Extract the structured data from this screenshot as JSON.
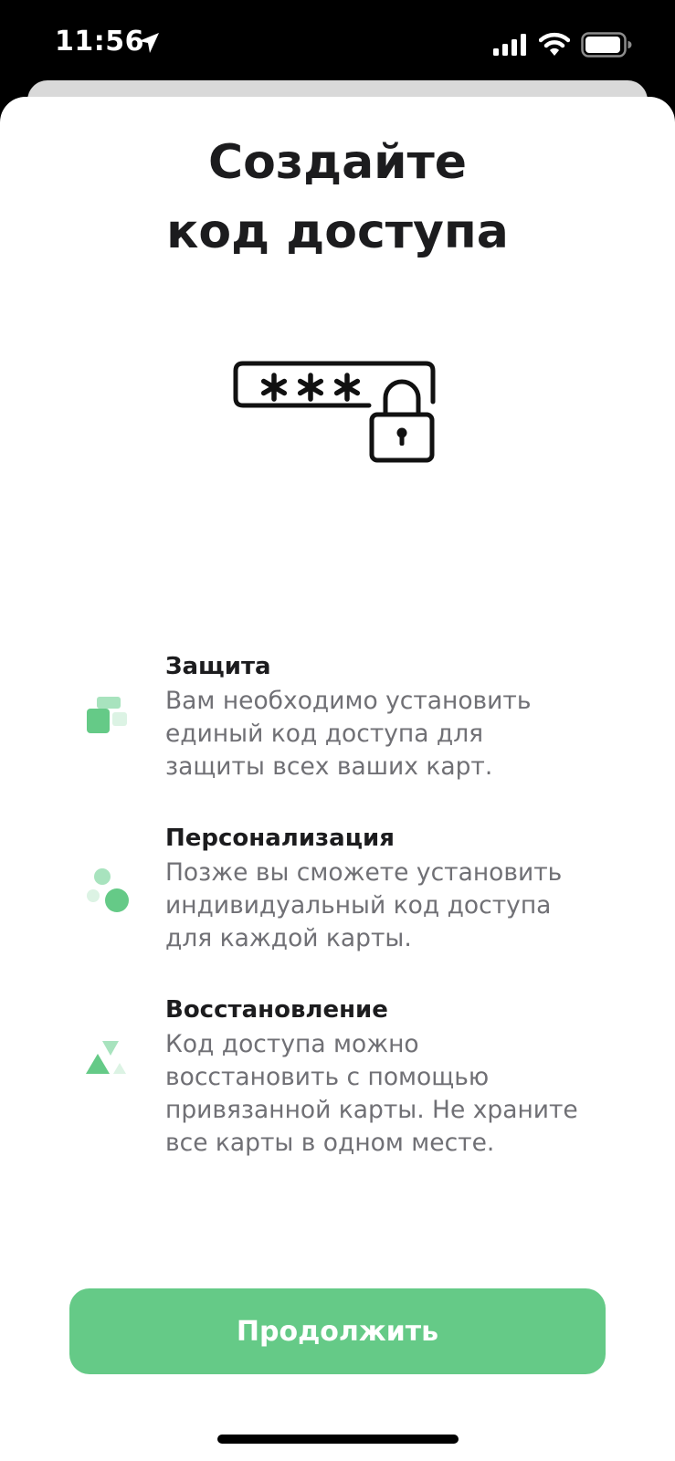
{
  "status_bar": {
    "time": "11:56",
    "icons": [
      "location-arrow-icon",
      "cellular-signal-icon",
      "wifi-icon",
      "battery-icon"
    ]
  },
  "title": {
    "line1": "Создайте",
    "line2": "код доступа"
  },
  "illustration": {
    "icon": "password-lock-icon",
    "masked_text": "***"
  },
  "features": [
    {
      "icon": "protection-blocks-icon",
      "title": "Защита",
      "desc_lines": [
        "Вам необходимо установить",
        "единый код доступа для",
        "защиты всех ваших карт."
      ]
    },
    {
      "icon": "personalization-dots-icon",
      "title": "Персонализация",
      "desc_lines": [
        "Позже вы сможете установить",
        "индивидуальный код доступа",
        "для каждой карты."
      ]
    },
    {
      "icon": "recovery-triangles-icon",
      "title": "Восстановление",
      "desc_lines": [
        "Код доступа можно",
        "восстановить с помощью",
        "привязанной карты. Не храните",
        "все карты в одном месте."
      ]
    }
  ],
  "continue_button": {
    "label": "Продолжить"
  },
  "colors": {
    "accent_green": "#65ca87",
    "light_green": "#a8e3be",
    "pale_green": "#dcf3e4",
    "text_primary": "#1c1c1e",
    "text_secondary": "#707075"
  }
}
